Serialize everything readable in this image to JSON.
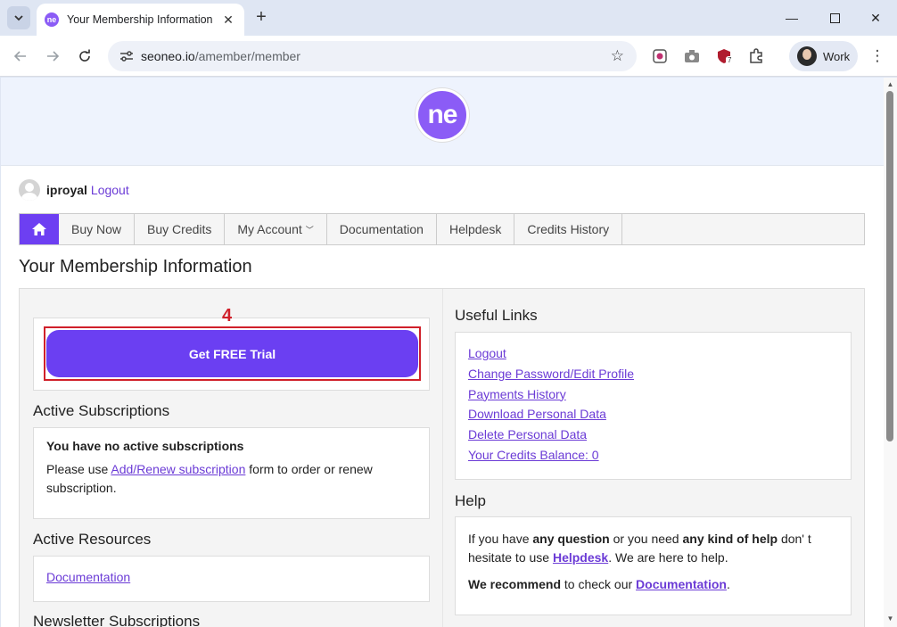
{
  "browser": {
    "tab_title": "Your Membership Information",
    "favicon_text": "ne",
    "url_host": "seoneo.io",
    "url_path": "/amember/member",
    "profile_label": "Work",
    "extension_badge": "7"
  },
  "site": {
    "logo_text": "ne",
    "brand_color": "#6b3ff2"
  },
  "user": {
    "name": "iproyal",
    "logout": "Logout"
  },
  "menu": {
    "items": [
      "Buy Now",
      "Buy Credits",
      "My Account",
      "Documentation",
      "Helpdesk",
      "Credits History"
    ]
  },
  "page": {
    "title": "Your Membership Information",
    "annotation_number": "4",
    "trial_button": "Get FREE Trial",
    "active_subscriptions": {
      "title": "Active Subscriptions",
      "heading": "You have no active subscriptions",
      "text_before": "Please use ",
      "link": "Add/Renew subscription",
      "text_after": " form to order or renew subscription."
    },
    "active_resources": {
      "title": "Active Resources",
      "link": "Documentation"
    },
    "newsletter": {
      "title": "Newsletter Subscriptions"
    },
    "useful_links": {
      "title": "Useful Links",
      "items": [
        "Logout",
        "Change Password/Edit Profile",
        "Payments History",
        "Download Personal Data",
        "Delete Personal Data",
        "Your Credits Balance: 0"
      ]
    },
    "help": {
      "title": "Help",
      "p1_a": "If you have ",
      "p1_b": "any question",
      "p1_c": " or you need ",
      "p1_d": "any kind of help",
      "p1_e": " don' t hesitate to use ",
      "p1_link": "Helpdesk",
      "p1_f": ". We are here to help.",
      "p2_a": "We recommend",
      "p2_b": " to check our ",
      "p2_link": "Documentation",
      "p2_c": "."
    }
  }
}
